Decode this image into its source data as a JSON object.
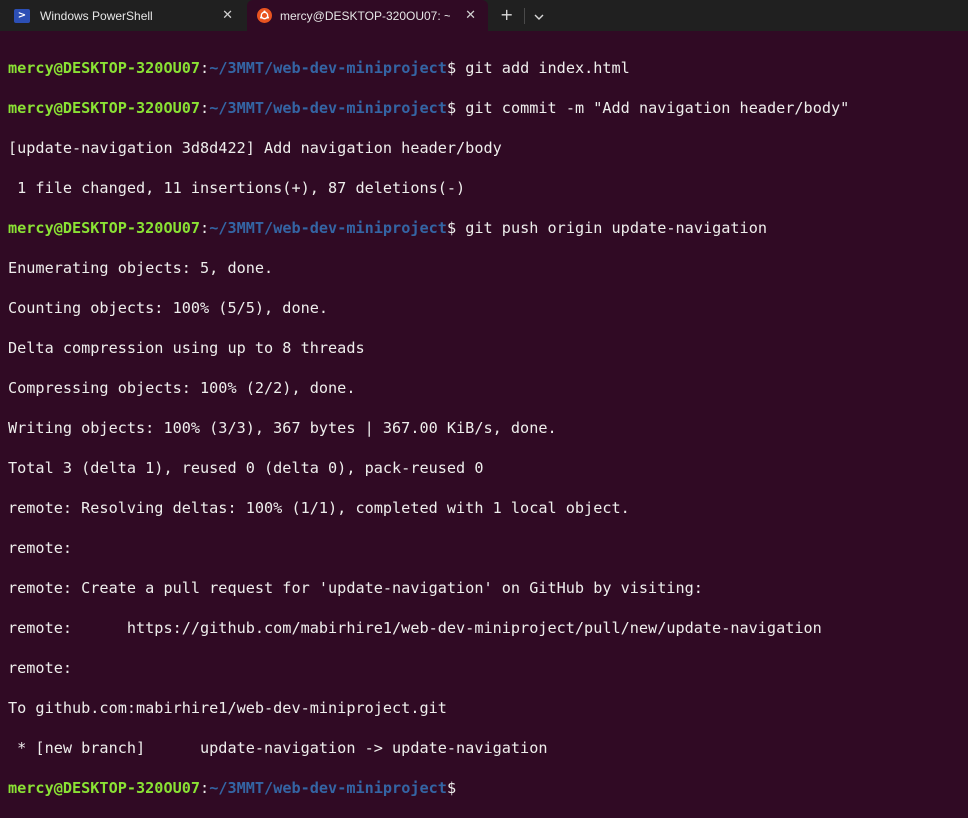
{
  "tabs": [
    {
      "title": "Windows PowerShell",
      "icon": "powershell-icon",
      "active": false
    },
    {
      "title": "mercy@DESKTOP-320OU07: ~",
      "icon": "ubuntu-icon",
      "active": true
    }
  ],
  "tabbar": {
    "new_tab_icon": "plus-icon",
    "dropdown_icon": "chevron-down-icon",
    "close_icon": "close-icon"
  },
  "colors": {
    "background": "#300a24",
    "prompt_user": "#8ae234",
    "prompt_path": "#3465a4",
    "text": "#eeeeec",
    "tabbar": "#202020"
  },
  "prompt": {
    "user": "mercy@DESKTOP-320OU07",
    "colon": ":",
    "path": "~/3MMT/web-dev-miniproject",
    "symbol": "$"
  },
  "terminal": {
    "cmd1": " git add index.html",
    "cmd2": " git commit -m \"Add navigation header/body\"",
    "out1": "[update-navigation 3d8d422] Add navigation header/body",
    "out2": " 1 file changed, 11 insertions(+), 87 deletions(-)",
    "cmd3": " git push origin update-navigation",
    "out3": "Enumerating objects: 5, done.",
    "out4": "Counting objects: 100% (5/5), done.",
    "out5": "Delta compression using up to 8 threads",
    "out6": "Compressing objects: 100% (2/2), done.",
    "out7": "Writing objects: 100% (3/3), 367 bytes | 367.00 KiB/s, done.",
    "out8": "Total 3 (delta 1), reused 0 (delta 0), pack-reused 0",
    "out9": "remote: Resolving deltas: 100% (1/1), completed with 1 local object.",
    "out10": "remote:",
    "out11": "remote: Create a pull request for 'update-navigation' on GitHub by visiting:",
    "out12": "remote:      https://github.com/mabirhire1/web-dev-miniproject/pull/new/update-navigation",
    "out13": "remote:",
    "out14": "To github.com:mabirhire1/web-dev-miniproject.git",
    "out15": " * [new branch]      update-navigation -> update-navigation"
  }
}
